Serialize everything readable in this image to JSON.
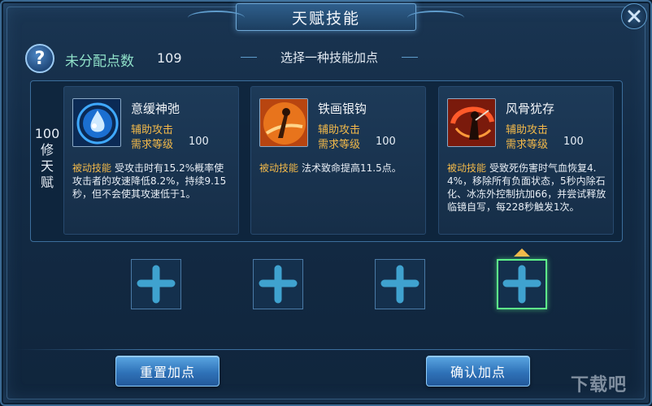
{
  "window": {
    "title": "天赋技能"
  },
  "header": {
    "help_glyph": "?",
    "unassigned_label": "未分配点数",
    "unassigned_value": "109",
    "instruction": "选择一种技能加点"
  },
  "tier": {
    "level": "100",
    "line2": "修",
    "line3": "天",
    "line4": "赋"
  },
  "talents": [
    {
      "name": "意缓神弛",
      "category": "辅助攻击",
      "req_label": "需求等级",
      "req_value": "100",
      "passive_tag": "被动技能",
      "description": "受攻击时有15.2%概率使攻击者的攻速降低8.2%，持续9.15秒，但不会使其攻速低于1。",
      "icon": "water-drop-icon"
    },
    {
      "name": "铁画银钩",
      "category": "辅助攻击",
      "req_label": "需求等级",
      "req_value": "100",
      "passive_tag": "被动技能",
      "description": "法术致命提高11.5点。",
      "icon": "brush-strike-icon"
    },
    {
      "name": "风骨犹存",
      "category": "辅助攻击",
      "req_label": "需求等级",
      "req_value": "100",
      "passive_tag": "被动技能",
      "description": "受致死伤害时气血恢复4.4%，移除所有负面状态，5秒内除石化、冰冻外控制抗加66，并尝试释放临镜自写，每228秒触发1次。",
      "icon": "warrior-swirl-icon"
    }
  ],
  "slots": [
    {
      "icon": "plus-icon",
      "selected": false
    },
    {
      "icon": "plus-icon",
      "selected": false
    },
    {
      "icon": "plus-icon",
      "selected": false
    },
    {
      "icon": "plus-icon",
      "selected": true
    }
  ],
  "buttons": {
    "reset": "重置加点",
    "confirm": "确认加点"
  },
  "watermark": "下载吧",
  "colors": {
    "accent_gold": "#f2b94a",
    "points_label": "#8fe0c8",
    "selected_slot": "#5ef28a",
    "button_blue": "#2f72b8"
  }
}
